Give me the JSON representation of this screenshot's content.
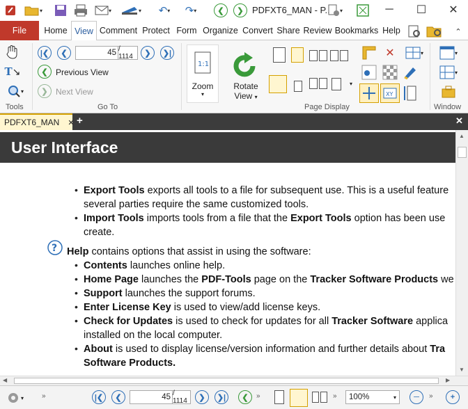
{
  "app": {
    "title": "PDFXT6_MAN - P..."
  },
  "ribbon_tabs": [
    "File",
    "Home",
    "View",
    "Comment",
    "Protect",
    "Form",
    "Organize",
    "Convert",
    "Share",
    "Review",
    "Bookmarks",
    "Help"
  ],
  "ribbon": {
    "groups": {
      "tools": "Tools",
      "goto": "Go To",
      "page_display": "Page Display",
      "window": "Window"
    },
    "page_current": "45",
    "page_total": "/ 1114",
    "previous_view": "Previous View",
    "next_view": "Next View",
    "zoom": "Zoom",
    "rotate_view_1": "Rotate",
    "rotate_view_2": "View"
  },
  "doc_tab": {
    "name": "PDFXT6_MAN"
  },
  "document": {
    "heading": "User Interface",
    "export_tools_b": "Export Tools",
    "export_tools_t": " exports all tools to a file for subsequent use. This is a useful feature",
    "export_tools_2": "several parties require the same customized tools.",
    "import_tools_b": "Import Tools",
    "import_tools_t": " imports tools from a file that the ",
    "import_tools_b2": "Export Tools",
    "import_tools_t2": " option has been use",
    "import_tools_2": "create.",
    "help_b": "Help",
    "help_t": " contains options that assist in using the software:",
    "contents_b": "Contents",
    "contents_t": " launches online help.",
    "home_b": "Home Page",
    "home_t1": " launches the ",
    "home_b2": "PDF-Tools",
    "home_t2": " page on the ",
    "home_b3": "Tracker Software Products",
    "home_t3": " we",
    "support_b": "Support",
    "support_t": " launches the support forums.",
    "license_b": "Enter License Key",
    "license_t": " is used to view/add license keys.",
    "updates_b": "Check for Updates",
    "updates_t": " is used to check for updates for all ",
    "updates_b2": "Tracker Software",
    "updates_t2": " applica",
    "updates_2": "installed on the local computer.",
    "about_b": "About",
    "about_t": " is used to display license/version information and further details about ",
    "about_b2": "Tra",
    "about_2": "Software Products."
  },
  "statusbar": {
    "page_current": "45",
    "page_total": "/ 1114",
    "zoom": "100%"
  },
  "colors": {
    "file_tab": "#c0392b",
    "accent": "#2a5d9f",
    "heading_bg": "#3a3a3a",
    "doc_tab": "#fff6d0"
  }
}
